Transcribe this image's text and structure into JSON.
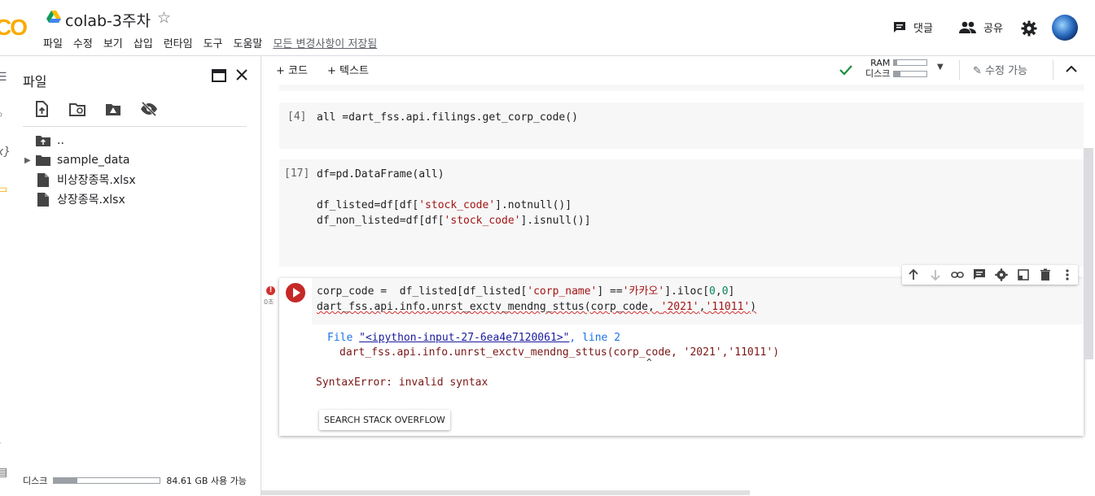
{
  "header": {
    "logo": "CO",
    "title": "colab-3주차",
    "menu": [
      "파일",
      "수정",
      "보기",
      "삽입",
      "런타임",
      "도구",
      "도움말"
    ],
    "save_status": "모든 변경사항이 저장됨",
    "comment_label": "댓글",
    "share_label": "공유"
  },
  "sidebar": {
    "title": "파일",
    "files": [
      {
        "name": "..",
        "type": "parent"
      },
      {
        "name": "sample_data",
        "type": "folder"
      },
      {
        "name": "비상장종목.xlsx",
        "type": "file"
      },
      {
        "name": "상장종목.xlsx",
        "type": "file"
      }
    ],
    "disk_label": "디스크",
    "disk_available": "84.61 GB 사용 가능",
    "disk_used_fraction": 0.22
  },
  "toolbar": {
    "add_code": "+ 코드",
    "add_text": "+ 텍스트",
    "ram_label": "RAM",
    "disk_label": "디스크",
    "ram_fraction": 0.1,
    "disk_fraction": 0.2,
    "edit_label": "수정 가능"
  },
  "cells": [
    {
      "prompt": "[4]",
      "lines": [
        "all =dart_fss.api.filings.get_corp_code()"
      ]
    },
    {
      "prompt": "[17]",
      "lines": [
        "df=pd.DataFrame(all)",
        "",
        "df_listed=df[df['stock_code'].notnull()]",
        "df_non_listed=df[df['stock_code'].isnull()]"
      ]
    }
  ],
  "active_cell": {
    "exec_time": "0초",
    "line1": "corp_code =  df_listed[df_listed['corp_name'] =='카카오'].iloc[0,0]",
    "line2": "dart_fss.api.info.unrst_exctv_mendng_sttus(corp_code, '2021','11011')",
    "output": {
      "file_prefix": "File ",
      "file_link": "\"<ipython-input-27-6ea4e7120061>\"",
      "line_info": ", line 2",
      "error_code": "dart_fss.api.info.unrst_exctv_mendng_sttus(corp_code, '2021','11011')",
      "caret": "^",
      "error_message": "SyntaxError: invalid syntax",
      "stack_button": "SEARCH STACK OVERFLOW"
    }
  },
  "colors": {
    "accent": "#f9ab00",
    "error": "#c62828",
    "string": "#a31515",
    "number": "#098658"
  }
}
